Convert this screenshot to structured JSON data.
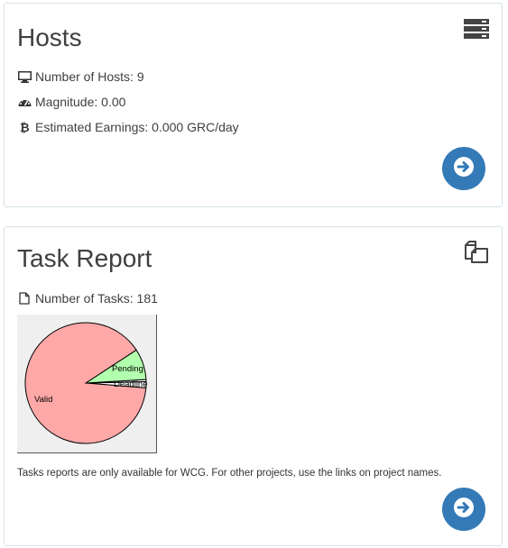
{
  "hosts": {
    "title": "Hosts",
    "icon": "server-stack-icon",
    "number_of_hosts": "Number of Hosts: 9",
    "magnitude": "Magnitude: 0.00",
    "earnings": "Estimated Earnings: 0.000 GRC/day",
    "go_icon": "arrow-right-icon"
  },
  "task_report": {
    "title": "Task Report",
    "icon": "copy-files-icon",
    "number_of_tasks": "Number of Tasks: 181",
    "note": "Tasks reports are only available for WCG. For other projects, use the links on project names.",
    "go_icon": "arrow-right-icon"
  },
  "colors": {
    "accent": "#337ab7",
    "valid_slice": "#ffa8a8",
    "pending_slice": "#b2ffae",
    "pie_background": "#efefef"
  },
  "chart_data": {
    "type": "pie",
    "slices": [
      {
        "label": "Valid",
        "value": 162,
        "color": "#ffa8a8"
      },
      {
        "label": "Pending",
        "value": 15,
        "color": "#b2ffae"
      },
      {
        "label": "",
        "value": 1,
        "color": "#ffffff"
      },
      {
        "label": "Deadline",
        "value": 3,
        "color": "#ffffff"
      }
    ]
  }
}
